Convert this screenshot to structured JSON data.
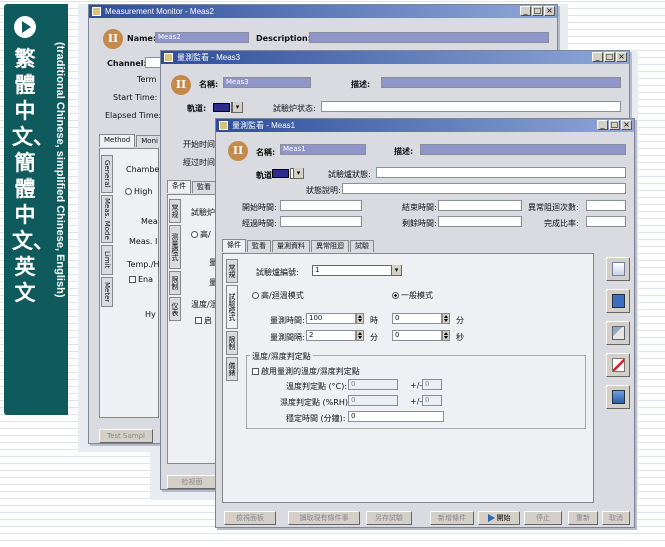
{
  "banner": {
    "vertical_text": "繁體中文、簡體中文、英文",
    "side_text": "(traditional Chinese, simplified Chinese, English)"
  },
  "win1": {
    "title": "Measurement Monitor - Meas2",
    "name_label": "Name:",
    "name_value": "Meas2",
    "desc_label": "Description:",
    "channel_label": "Channel:",
    "term_label": "Term",
    "start_label": "Start Time:",
    "elapsed_label": "Elapsed Time:",
    "tab_method": "Method",
    "tab_monitor": "Moni",
    "vtabs": [
      "General",
      "Meas. Mode",
      "Limit",
      "Meter"
    ],
    "chamber_label": "Chambe",
    "high_label": "High",
    "meas_label": "Mea",
    "meas2_label": "Meas. I",
    "temp_label": "Temp./H",
    "enable_label": "Ena",
    "hy_label": "Hy",
    "bottom_btn": "Test Sampl"
  },
  "win2": {
    "title": "量測監看 - Meas3",
    "name_label": "名稱:",
    "name_value": "Meas3",
    "desc_label": "描述:",
    "channel_label": "軌道:",
    "status_label": "試驗炉状态:",
    "start_label": "开始时间",
    "elapsed_label": "經过时间",
    "tab1": "条件",
    "tab2": "監看",
    "vtabs": [
      "常规",
      "测量模式",
      "限制",
      "仪表"
    ],
    "furnace_label": "試驗炉",
    "high_label": "高/",
    "meas_label": "量",
    "meas2_label": "量",
    "temp_label": "温度/湿",
    "enable_label": "启",
    "bottom_btn": "检视面"
  },
  "win3": {
    "title": "量測監看 - Meas1",
    "name_label": "名稱:",
    "name_value": "Meas1",
    "desc_label": "描述:",
    "channel_label": "軌道:",
    "furnace_status_label": "試驗爐狀態:",
    "status_desc_label": "狀態說明:",
    "start_label": "開始時間:",
    "end_label": "結束時間:",
    "abnormal_label": "異常阻迴次數:",
    "elapsed_label": "經過時間:",
    "remain_label": "剩餘時間:",
    "complete_label": "完成比率:",
    "tabs": [
      "條件",
      "監看",
      "量測資料",
      "異常阻迴",
      "試驗"
    ],
    "vtabs": [
      "常規",
      "試驗模式",
      "限制",
      "儀錶"
    ],
    "furnace_label": "試驗爐編號:",
    "furnace_value": "1",
    "mode_high": "高/迴溫模式",
    "mode_normal": "一般模式",
    "meas_time_label": "量測時間:",
    "meas_time_value": "100",
    "meas_time_unit1": "時",
    "meas_time_value2": "0",
    "meas_time_unit2": "分",
    "interval_label": "量測間隔:",
    "interval_value": "2",
    "interval_unit1": "分",
    "interval_value2": "0",
    "interval_unit2": "秒",
    "temp_group_label": "溫度/濕度判定點",
    "temp_enable_label": "啟用量測的溫度/濕度判定點",
    "temp_point_label": "溫度判定點 (°C):",
    "temp_point_value": "0",
    "temp_pm": "+/-",
    "temp_pm_value": "0",
    "humid_point_label": "濕度判定點 (%RH):",
    "humid_point_value": "0",
    "humid_pm": "+/-",
    "humid_pm_value": "0",
    "stable_label": "穩定時間 (分鐘):",
    "stable_value": "0",
    "buttons": [
      "檢視面板",
      "讀取現有條件事",
      "另存試驗",
      "新增條件",
      "開始",
      "停止",
      "重新",
      "取消"
    ]
  }
}
